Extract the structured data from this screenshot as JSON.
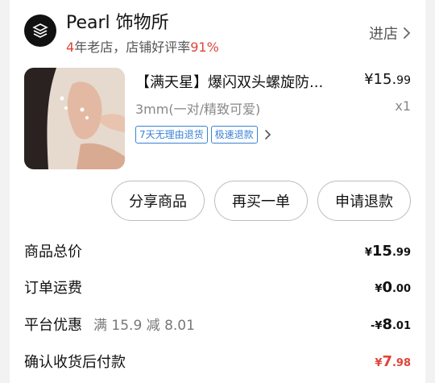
{
  "shop": {
    "name": "Pearl 饰物所",
    "years": "4",
    "years_suffix": "年老店，店铺好评率",
    "rating": "91%",
    "enter_label": "进店"
  },
  "product": {
    "title": "【满天星】爆闪双头螺旋防...",
    "price_main": "¥15.",
    "price_cents": "99",
    "spec": "3mm(一对/精致可爱)",
    "qty": "x1",
    "tags": [
      "7天无理由退货",
      "极速退款"
    ]
  },
  "actions": {
    "share": "分享商品",
    "rebuy": "再买一单",
    "refund": "申请退款"
  },
  "summary": {
    "total_goods": {
      "label": "商品总价",
      "yen": "¥",
      "main": "15",
      "cents": ".99"
    },
    "shipping": {
      "label": "订单运费",
      "yen": "¥",
      "main": "0",
      "cents": ".00"
    },
    "discount": {
      "label": "平台优惠",
      "note": "满 15.9 减 8.01",
      "yen": "-¥",
      "main": "8",
      "cents": ".01"
    },
    "pay": {
      "label": "确认收货后付款",
      "yen": "¥",
      "main": "7",
      "cents": ".98"
    }
  },
  "colors": {
    "accent_red": "#e0443a",
    "tag_blue": "#3b82d6"
  },
  "icons": [
    "shop-logo-icon",
    "chevron-right-icon"
  ]
}
